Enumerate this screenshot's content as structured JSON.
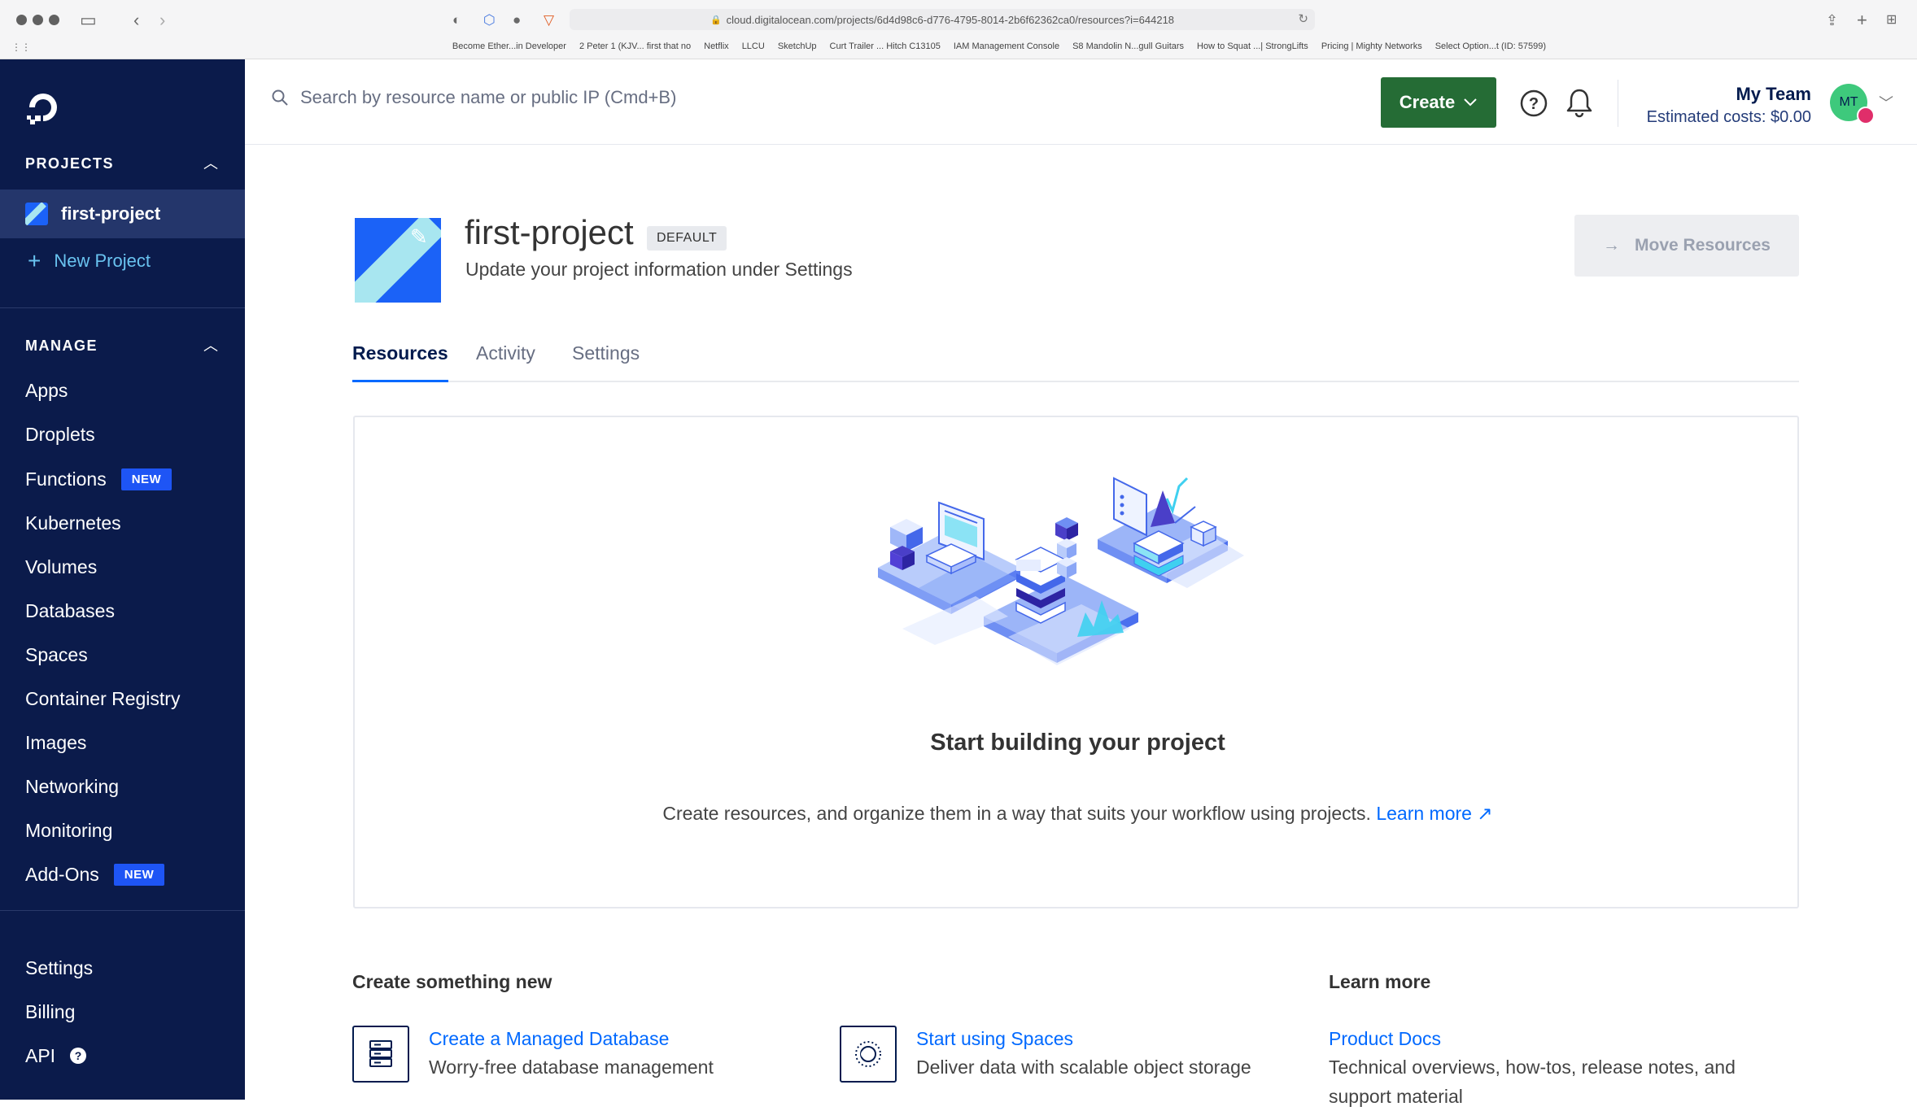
{
  "browser": {
    "url_host": "cloud.digitalocean.com",
    "url_path": "/projects/6d4d98c6-d776-4795-8014-2b6f62362ca0/resources?i=644218",
    "favorites": [
      "Become Ether...in Developer",
      "2 Peter 1 (KJV... first that no",
      "Netflix",
      "LLCU",
      "SketchUp",
      "Curt Trailer ... Hitch C13105",
      "IAM Management Console",
      "S8 Mandolin N...gull Guitars",
      "How to Squat ...| StrongLifts",
      "Pricing | Mighty Networks",
      "Select Option...t (ID: 57599)"
    ]
  },
  "sidebar": {
    "projects_header": "PROJECTS",
    "active_project": "first-project",
    "new_project": "New Project",
    "manage_header": "MANAGE",
    "items": [
      {
        "label": "Apps"
      },
      {
        "label": "Droplets"
      },
      {
        "label": "Functions",
        "badge": "NEW"
      },
      {
        "label": "Kubernetes"
      },
      {
        "label": "Volumes"
      },
      {
        "label": "Databases"
      },
      {
        "label": "Spaces"
      },
      {
        "label": "Container Registry"
      },
      {
        "label": "Images"
      },
      {
        "label": "Networking"
      },
      {
        "label": "Monitoring"
      },
      {
        "label": "Add-Ons",
        "badge": "NEW"
      }
    ],
    "bottom_items": [
      {
        "label": "Settings"
      },
      {
        "label": "Billing"
      },
      {
        "label": "API"
      }
    ]
  },
  "topbar": {
    "search_placeholder": "Search by resource name or public IP (Cmd+B)",
    "create_label": "Create",
    "team_name": "My Team",
    "estimated_costs": "Estimated costs: $0.00",
    "avatar_initials": "MT"
  },
  "project": {
    "title": "first-project",
    "badge": "DEFAULT",
    "subtitle": "Update your project information under Settings",
    "move_resources": "Move Resources"
  },
  "tabs": [
    {
      "label": "Resources",
      "active": true
    },
    {
      "label": "Activity"
    },
    {
      "label": "Settings"
    }
  ],
  "empty_state": {
    "title": "Start building your project",
    "text": "Create resources, and organize them in a way that suits your workflow using projects.",
    "link": "Learn more"
  },
  "create_something_new": {
    "header": "Create something new",
    "items": [
      {
        "title": "Create a Managed Database",
        "desc": "Worry-free database management"
      },
      {
        "title": "Start using Spaces",
        "desc": "Deliver data with scalable object storage"
      }
    ]
  },
  "learn_more": {
    "header": "Learn more",
    "items": [
      {
        "title": "Product Docs",
        "desc": "Technical overviews, how-tos, release notes, and support material"
      }
    ]
  }
}
